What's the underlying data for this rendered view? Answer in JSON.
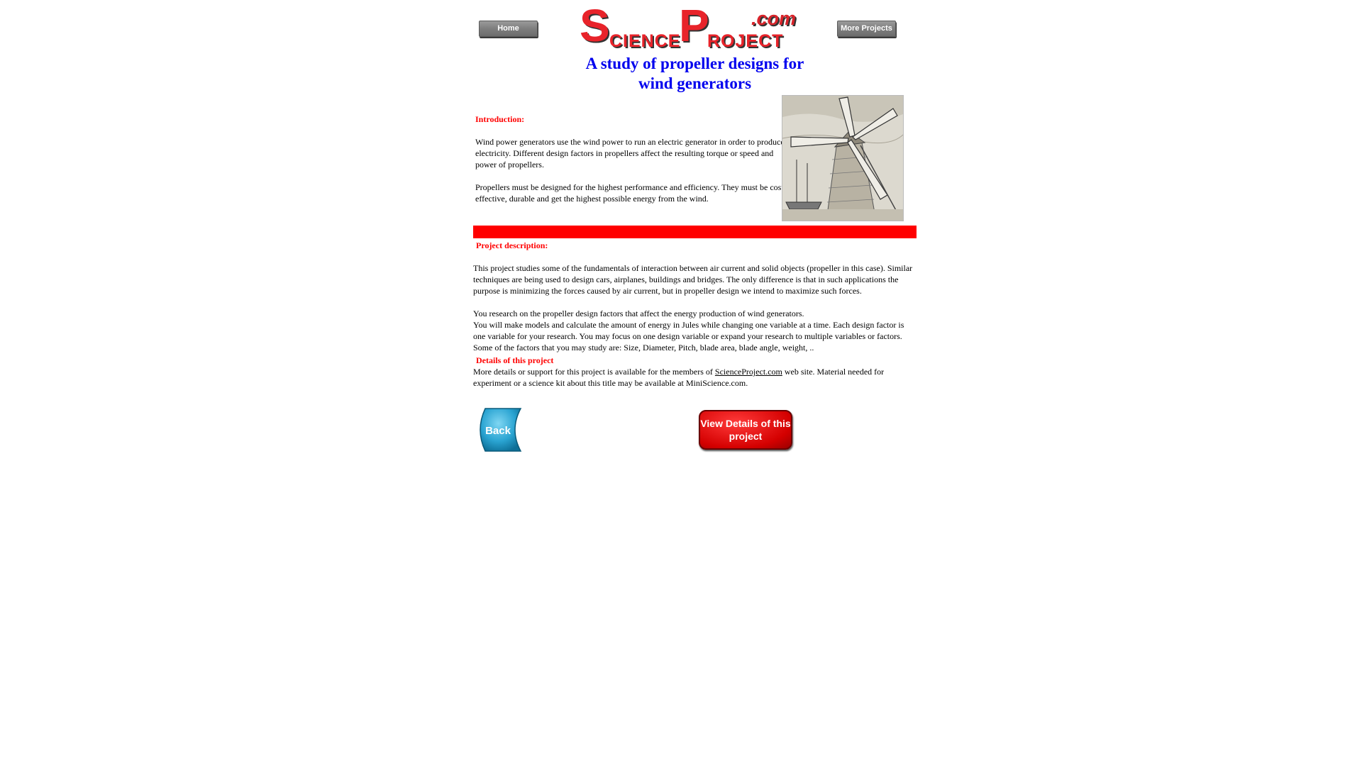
{
  "header": {
    "home_label": "Home",
    "more_projects_label": "More Projects",
    "logo": {
      "s": "S",
      "cience": "CIENCE",
      "p": "P",
      "roject": "ROJECT",
      "dotcom": ".com"
    },
    "title": "A study of propeller designs for wind generators"
  },
  "intro": {
    "heading": "Introduction:",
    "paragraph1": "Wind power generators use the wind power to run an electric generator in order to produce electricity. Different design factors in propellers affect the resulting torque or speed and power of propellers.",
    "paragraph2": "Propellers must be designed for the highest performance and efficiency. They must be cost effective, durable and get the highest possible energy from the wind."
  },
  "description": {
    "heading": "Project description:",
    "paragraph1": "This project studies some of the fundamentals of interaction between air current and solid objects (propeller in this case). Similar techniques are being used to design cars, airplanes, buildings and bridges.  The only difference is that in such applications the purpose is minimizing the forces caused by air current, but in propeller design we intend to maximize such forces.",
    "paragraph2a": "You research on the propeller design factors that affect the energy production of wind generators.",
    "paragraph2b": "You will make models and calculate the amount of energy in Jules while changing one variable at a time. Each design factor is one variable for your research. You may focus on one design variable or expand your research to multiple variables or factors.  Some of the factors that you may study are: Size, Diameter, Pitch, blade area, blade angle, weight, ..",
    "details_heading": "Details of this project",
    "details_prefix": "More details or support for this project is available for the members of ",
    "details_link": "ScienceProject.com",
    "details_suffix": " web site. Material needed for experiment or a science kit about this title may be available at MiniScience.com."
  },
  "buttons": {
    "back_label": "Back",
    "view_details_label": "View Details of this project"
  },
  "colors": {
    "accent_red": "#ff0000",
    "title_blue": "#0000ee",
    "logo_red": "#e8232a"
  }
}
